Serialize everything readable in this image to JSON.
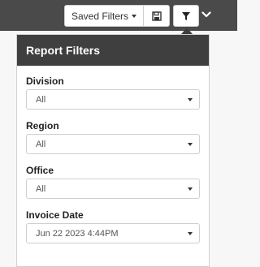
{
  "toolbar": {
    "saved_filters_label": "Saved Filters",
    "save_icon": "save-icon",
    "filter_icon": "filter-icon",
    "chevron_icon": "chevron-down-icon"
  },
  "panel": {
    "title": "Report Filters",
    "fields": [
      {
        "label": "Division",
        "value": "All"
      },
      {
        "label": "Region",
        "value": "All"
      },
      {
        "label": "Office",
        "value": "All"
      },
      {
        "label": "Invoice Date",
        "value": "Jun 22 2023 4:44PM"
      }
    ]
  },
  "colors": {
    "topbar": "#4a4a4a",
    "panel_header": "#3f3f3f"
  }
}
